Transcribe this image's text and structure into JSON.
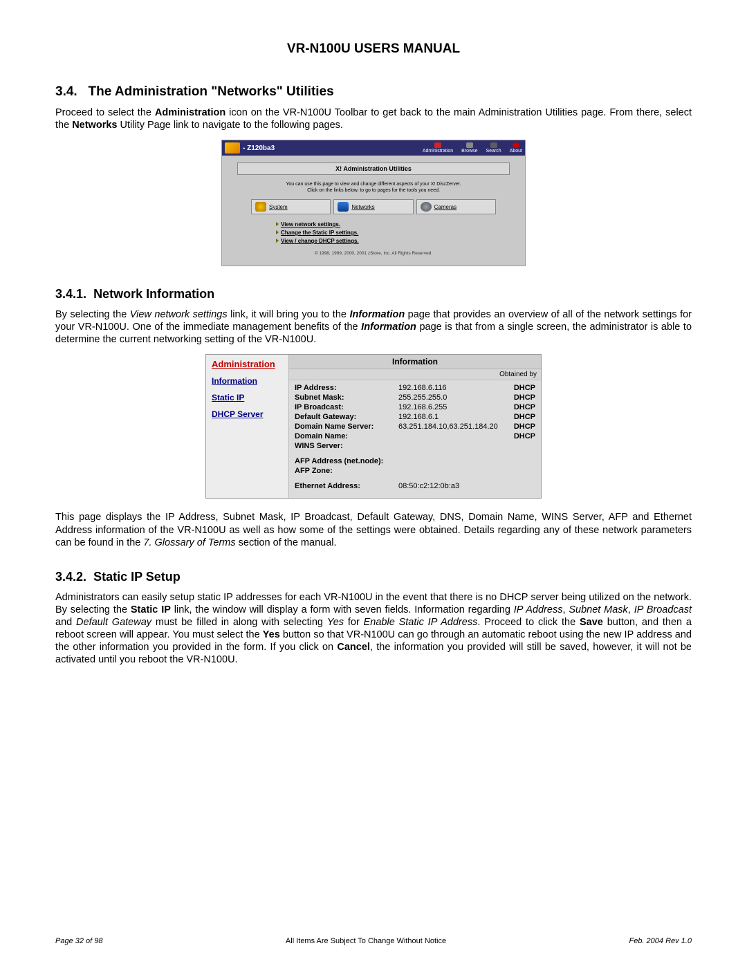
{
  "doc": {
    "title": "VR-N100U USERS MANUAL",
    "sec34_num": "3.4.",
    "sec34_title": "The Administration \"Networks\" Utilities",
    "sec341_num": "3.4.1.",
    "sec341_title": "Network Information",
    "sec342_num": "3.4.2.",
    "sec342_title": "Static IP Setup",
    "footer_left": "Page 32 of 98",
    "footer_mid": "All Items Are Subject To Change Without Notice",
    "footer_right": "Feb. 2004 Rev 1.0"
  },
  "p34": {
    "t1": "Proceed to select the ",
    "b1": "Administration",
    "t2": " icon on the VR-N100U Toolbar to get back to the main Administration Utilities page. From there, select the ",
    "b2": "Networks",
    "t3": " Utility Page link to navigate to the following pages."
  },
  "ss1": {
    "host": "- Z120ba3",
    "nav": {
      "admin": "Administration",
      "browse": "Browse",
      "search": "Search",
      "about": "About"
    },
    "banner": "X! Administration Utilities",
    "sub1": "You can use this page to view and change different aspects of your X! DiscZerver.",
    "sub2": "Click on the links below, to go to pages for the tools you need.",
    "tabs": {
      "system": "System",
      "networks": "Networks",
      "cameras": "Cameras"
    },
    "links": {
      "l1": "View network settings.",
      "l2": "Change the Static IP settings.",
      "l3": "View / change DHCP settings."
    },
    "copyright": "© 1998, 1999, 2000, 2001 zStore, Inc. All Rights Reserved."
  },
  "p341a": {
    "t1": "By selecting the ",
    "i1": "View network settings ",
    "t2": "link, it will bring you to the ",
    "bi1": "Information",
    "t3": " page that provides an overview of all of the network settings for your VR-N100U. One of the immediate management benefits of the ",
    "bi2": "Information",
    "t4": " page is that from a single screen, the administrator is able to determine the current networking setting of the VR-N100U."
  },
  "ss2": {
    "side": {
      "admin": "Administration",
      "info": "Information",
      "static": "Static IP",
      "dhcp": "DHCP Server"
    },
    "title": "Information",
    "obtained": "Obtained by",
    "rows": [
      {
        "k": "IP Address:",
        "v": "192.168.6.116",
        "s": "DHCP"
      },
      {
        "k": "Subnet Mask:",
        "v": "255.255.255.0",
        "s": "DHCP"
      },
      {
        "k": "IP Broadcast:",
        "v": "192.168.6.255",
        "s": "DHCP"
      },
      {
        "k": "Default Gateway:",
        "v": "192.168.6.1",
        "s": "DHCP"
      },
      {
        "k": "Domain Name Server:",
        "v": "63.251.184.10,63.251.184.20",
        "s": "DHCP"
      },
      {
        "k": "Domain Name:",
        "v": "",
        "s": "DHCP"
      },
      {
        "k": "WINS Server:",
        "v": "",
        "s": ""
      }
    ],
    "afp_addr_k": "AFP Address (net.node):",
    "afp_zone_k": "AFP Zone:",
    "eth_k": "Ethernet Address:",
    "eth_v": "08:50:c2:12:0b:a3"
  },
  "p341b": {
    "t1": "This page displays the IP Address, Subnet Mask, IP Broadcast, Default Gateway, DNS, Domain Name, WINS Server, AFP and Ethernet Address information of the VR-N100U as well as how some of the settings were obtained. Details regarding any of these network parameters can be found in the ",
    "i1": "7. Glossary of Terms",
    "t2": " section of the manual."
  },
  "p342": {
    "t1": "Administrators can easily setup static IP addresses for each VR-N100U in the event that there is no DHCP server being utilized on the network. By selecting the ",
    "b1": "Static IP",
    "t2": " link, the window will display a form with seven fields. Information regarding ",
    "i1": "IP Address",
    "c1": ", ",
    "i2": "Subnet Mask",
    "c2": ", ",
    "i3": "IP Broadcast",
    "c3": " and ",
    "i4": "Default Gateway",
    "t3": " must be filled in along with selecting ",
    "i5": "Yes",
    "t4": " for ",
    "i6": "Enable Static IP Address",
    "t5": ". Proceed to click the ",
    "b2": "Save",
    "t6": " button, and then a reboot screen will appear. You must select the ",
    "b3": "Yes",
    "t7": " button so that VR-N100U can go through an automatic reboot using the new IP address and the other information you provided in the form.  If you click on ",
    "b4": "Cancel",
    "t8": ", the information you provided will still be saved, however, it will not be activated until you reboot the VR-N100U."
  }
}
